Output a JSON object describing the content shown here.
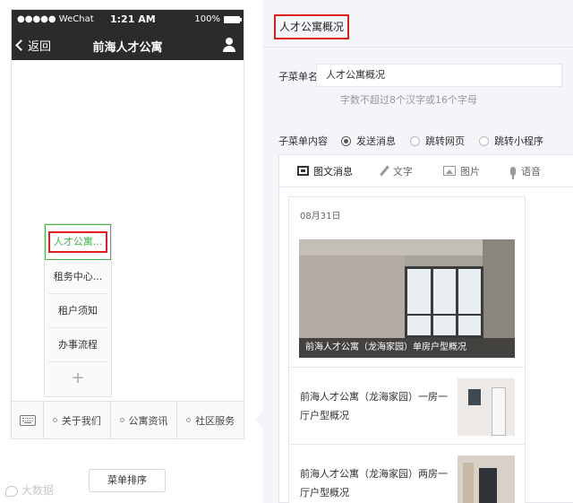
{
  "phone": {
    "status": {
      "carrier": "●●●●● WeChat",
      "time": "1:21 AM",
      "battery": "100%"
    },
    "nav": {
      "back_label": "返回",
      "title": "前海人才公寓"
    },
    "submenu": {
      "items": [
        {
          "label": "人才公寓..."
        },
        {
          "label": "租务中心..."
        },
        {
          "label": "租户须知"
        },
        {
          "label": "办事流程"
        }
      ],
      "add_label": "+"
    },
    "menu_tabs": [
      {
        "label": "关于我们"
      },
      {
        "label": "公寓资讯"
      },
      {
        "label": "社区服务"
      }
    ]
  },
  "sort_button_label": "菜单排序",
  "watermark": "大数据",
  "editor": {
    "title": "人才公寓概况",
    "name_label": "子菜单名称",
    "name_value": "人才公寓概况",
    "name_hint": "字数不超过8个汉字或16个字母",
    "content_label": "子菜单内容",
    "radio_options": [
      {
        "label": "发送消息",
        "checked": true
      },
      {
        "label": "跳转网页",
        "checked": false
      },
      {
        "label": "跳转小程序",
        "checked": false
      }
    ],
    "type_tabs": [
      {
        "label": "图文消息",
        "icon": "news-icon"
      },
      {
        "label": "文字",
        "icon": "pencil-icon"
      },
      {
        "label": "图片",
        "icon": "image-icon"
      },
      {
        "label": "语音",
        "icon": "microphone-icon"
      }
    ],
    "article": {
      "date": "08月31日",
      "cover_caption": "前海人才公寓（龙海家园）单房户型概况",
      "sub_articles": [
        {
          "title": "前海人才公寓（龙海家园）一房一厅户型概况"
        },
        {
          "title": "前海人才公寓（龙海家园）两房一厅户型概况"
        }
      ]
    }
  }
}
